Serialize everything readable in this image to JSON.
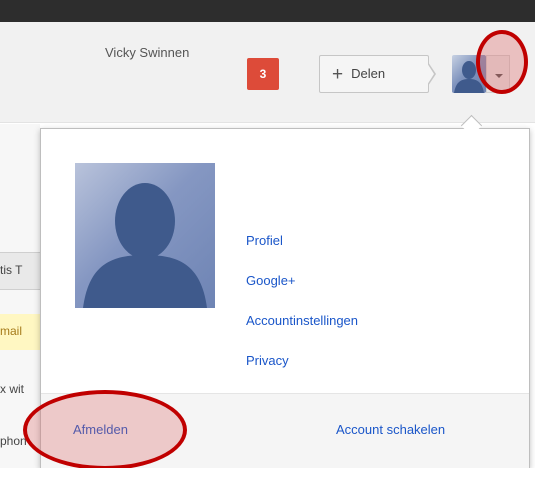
{
  "header": {
    "user_name": "Vicky Swinnen",
    "notifications_count": "3",
    "share_label": "Delen",
    "share_icon": "plus"
  },
  "dropdown": {
    "links": [
      "Profiel",
      "Google+",
      "Accountinstellingen",
      "Privacy"
    ],
    "signout_label": "Afmelden",
    "switch_account_label": "Account schakelen"
  },
  "background_list": {
    "rows": [
      "tis T",
      "mail",
      "x wit",
      "phon"
    ]
  },
  "icons": {
    "avatar": "user-silhouette-icon",
    "menu": "chevron-down-icon"
  },
  "colors": {
    "topbar": "#2d2d2d",
    "header": "#f1f1f1",
    "notification": "#dd4b39",
    "link": "#1a56c9",
    "highlight": "#c00000"
  }
}
